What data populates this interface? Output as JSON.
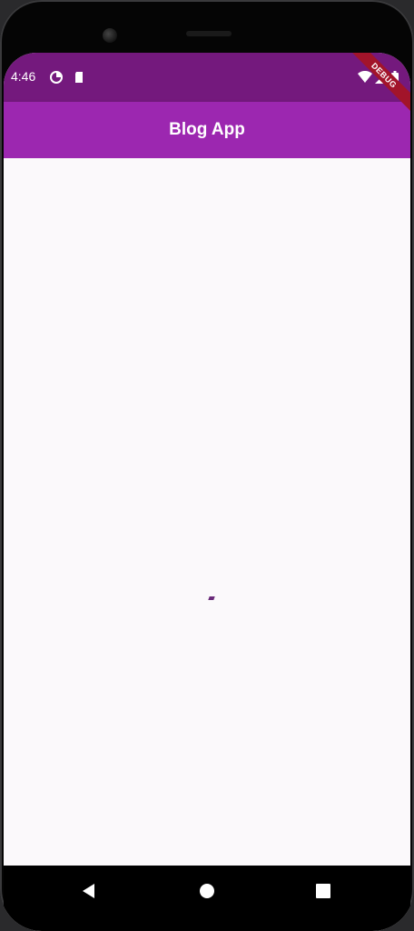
{
  "status_bar": {
    "time": "4:46",
    "icons": [
      "data-saver-icon",
      "sd-card-icon",
      "wifi-icon",
      "signal-icon",
      "battery-icon"
    ]
  },
  "app_bar": {
    "title": "Blog App"
  },
  "debug_banner": {
    "label": "DEBUG"
  },
  "content": {
    "state": "loading"
  },
  "nav_bar": {
    "buttons": [
      "back-icon",
      "home-icon",
      "recents-icon"
    ]
  },
  "colors": {
    "status_bar": "#74197d",
    "app_bar": "#9c27b0",
    "background": "#fbf9fb",
    "banner": "#a2142a"
  }
}
